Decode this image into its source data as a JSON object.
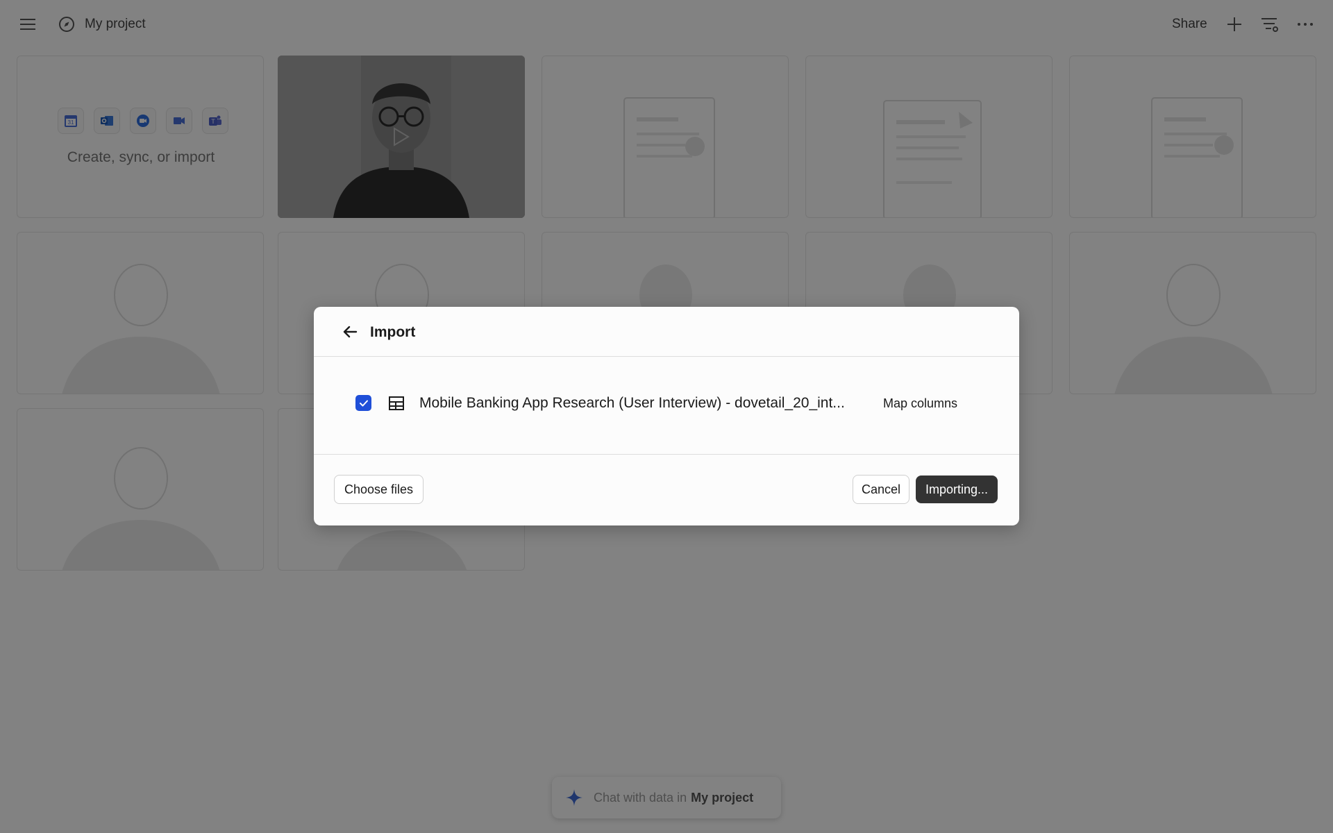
{
  "header": {
    "project_title": "My project",
    "share_label": "Share",
    "icons": [
      "hamburger-menu-icon",
      "compass-icon",
      "plus-icon",
      "filter-settings-icon",
      "more-horizontal-icon"
    ]
  },
  "grid": {
    "create_text": "Create, sync, or import",
    "integrations": [
      "google-calendar-icon",
      "outlook-icon",
      "zoom-icon",
      "google-meet-icon",
      "teams-icon"
    ]
  },
  "chat": {
    "prefix": "Chat with data in",
    "project": "My project",
    "icon": "sparkle-icon"
  },
  "modal": {
    "title": "Import",
    "file": {
      "name": "Mobile Banking App Research (User Interview) - dovetail_20_int...",
      "checked": true,
      "icon": "table-icon"
    },
    "map_columns_label": "Map columns",
    "choose_files_label": "Choose files",
    "cancel_label": "Cancel",
    "importing_label": "Importing..."
  },
  "colors": {
    "overlay": "rgba(0,0,0,0.49)",
    "checkbox": "#1f4fd8",
    "primary_button": "#333333"
  }
}
